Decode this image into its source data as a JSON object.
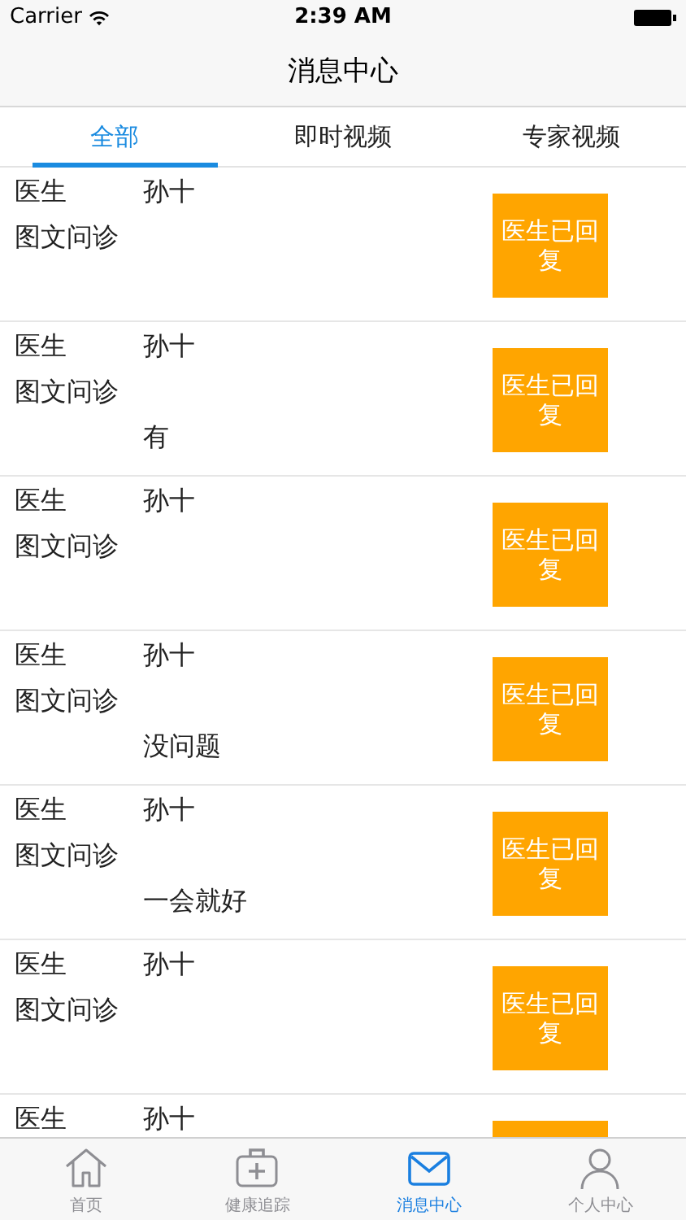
{
  "status_bar": {
    "carrier": "Carrier",
    "time": "2:39 AM"
  },
  "nav_bar": {
    "title": "消息中心"
  },
  "tabs": [
    {
      "label": "全部",
      "selected": true
    },
    {
      "label": "即时视频",
      "selected": false
    },
    {
      "label": "专家视频",
      "selected": false
    }
  ],
  "messages": [
    {
      "role": "医生",
      "name": "孙十",
      "type": "图文问诊",
      "status": "医生已回复"
    },
    {
      "role": "医生",
      "name": "孙十",
      "type": "图文问诊",
      "content": "有",
      "status": "医生已回复"
    },
    {
      "role": "医生",
      "name": "孙十",
      "type": "图文问诊",
      "status": "医生已回复"
    },
    {
      "role": "医生",
      "name": "孙十",
      "type": "图文问诊",
      "content": "没问题",
      "status": "医生已回复"
    },
    {
      "role": "医生",
      "name": "孙十",
      "type": "图文问诊",
      "content": "一会就好",
      "status": "医生已回复"
    },
    {
      "role": "医生",
      "name": "孙十",
      "type": "图文问诊",
      "status": "医生已回复"
    },
    {
      "role": "医生",
      "name": "孙十"
    }
  ],
  "tab_bar": [
    {
      "label": "首页",
      "selected": false
    },
    {
      "label": "健康追踪",
      "selected": false
    },
    {
      "label": "消息中心",
      "selected": true
    },
    {
      "label": "个人中心",
      "selected": false
    }
  ]
}
